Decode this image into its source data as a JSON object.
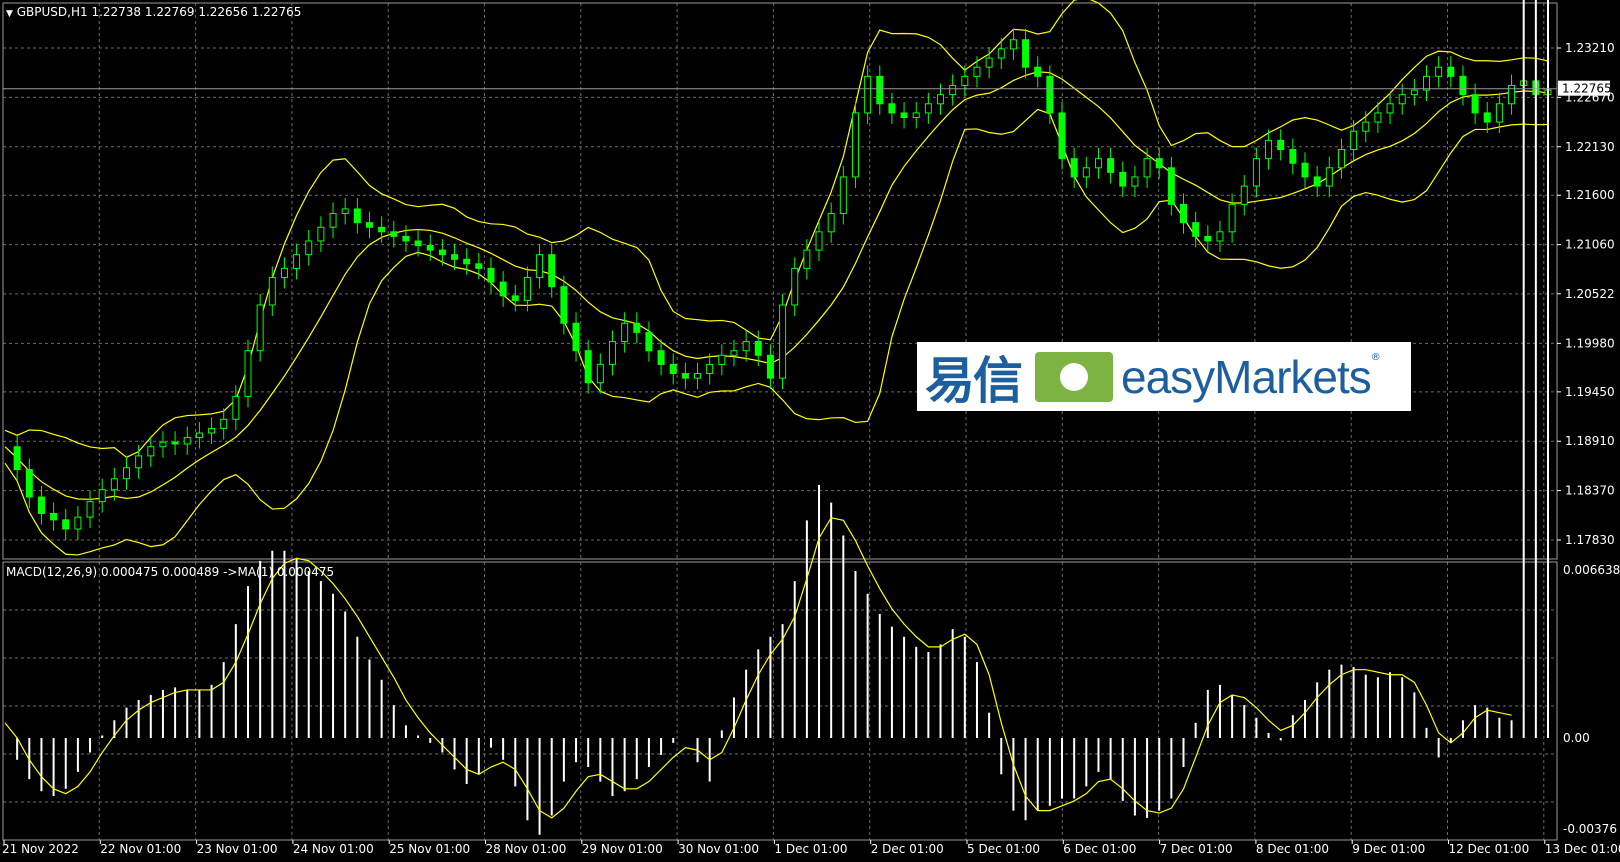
{
  "header": {
    "symbol_line": "GBPUSD,H1  1.22738 1.22769 1.22656 1.22765",
    "macd_line": "MACD(12,26,9) 0.000475 0.000489  ->MA(1) 0.000475"
  },
  "watermark": {
    "cn_text": "易信",
    "brand_text": "easyMarkets",
    "reg_mark": "®"
  },
  "colors": {
    "background": "#000000",
    "grid": "#6b6b6b",
    "candles": "#00ff00",
    "bands": "#ffff00",
    "macd_hist": "#ffffff",
    "signal": "#ffff00",
    "current_price_bg": "#ffffff"
  },
  "chart_data": [
    {
      "type": "line",
      "title": "GBPUSD,H1",
      "ohlc_last": {
        "open": 1.22738,
        "high": 1.22769,
        "low": 1.22656,
        "close": 1.22765
      },
      "current_price_label": "1.22765",
      "y_ticks": [
        "1.23210",
        "1.22670",
        "1.22130",
        "1.21600",
        "1.21060",
        "1.20522",
        "1.19980",
        "1.19450",
        "1.18910",
        "1.18370",
        "1.17830"
      ],
      "ylim": [
        1.1775,
        1.2365
      ],
      "x_ticks": [
        "21 Nov 2022",
        "22 Nov 01:00",
        "23 Nov 01:00",
        "24 Nov 01:00",
        "25 Nov 01:00",
        "28 Nov 01:00",
        "29 Nov 01:00",
        "30 Nov 01:00",
        "1 Dec 01:00",
        "2 Dec 01:00",
        "5 Dec 01:00",
        "6 Dec 01:00",
        "7 Dec 01:00",
        "8 Dec 01:00",
        "9 Dec 01:00",
        "12 Dec 01:00",
        "13 Dec 01:00"
      ],
      "grid": true,
      "series": [
        {
          "values": [
            1.1885,
            1.186,
            1.183,
            1.1812,
            1.1805,
            1.1795,
            1.1808,
            1.1825,
            1.1838,
            1.185,
            1.1862,
            1.1875,
            1.1885,
            1.189,
            1.1888,
            1.1895,
            1.19,
            1.1905,
            1.1915,
            1.194,
            1.199,
            1.204,
            1.207,
            1.208,
            1.2095,
            1.211,
            1.2125,
            1.214,
            1.2145,
            1.213,
            1.2125,
            1.212,
            1.2115,
            1.211,
            1.2105,
            1.21,
            1.2095,
            1.209,
            1.2085,
            1.208,
            1.2065,
            1.205,
            1.2045,
            1.207,
            1.2095,
            1.206,
            1.202,
            1.199,
            1.1955,
            1.1975,
            1.2,
            1.202,
            1.201,
            1.199,
            1.1975,
            1.1965,
            1.196,
            1.1965,
            1.1975,
            1.1985,
            1.199,
            1.2,
            1.1985,
            1.196,
            1.204,
            1.208,
            1.21,
            1.212,
            1.214,
            1.218,
            1.225,
            1.229,
            1.226,
            1.225,
            1.2245,
            1.225,
            1.226,
            1.227,
            1.228,
            1.229,
            1.23,
            1.231,
            1.232,
            1.233,
            1.23,
            1.229,
            1.225,
            1.22,
            1.218,
            1.219,
            1.22,
            1.2185,
            1.217,
            1.218,
            1.22,
            1.219,
            1.215,
            1.213,
            1.2115,
            1.211,
            1.212,
            1.215,
            1.217,
            1.22,
            1.222,
            1.221,
            1.2195,
            1.218,
            1.217,
            1.219,
            1.221,
            1.223,
            1.224,
            1.225,
            1.226,
            1.227,
            1.2275,
            1.229,
            1.23,
            1.229,
            1.227,
            1.225,
            1.224,
            1.226,
            1.228,
            1.2285,
            1.227,
            1.2275
          ]
        }
      ]
    },
    {
      "type": "bar",
      "title": "MACD(12,26,9)",
      "y_ticks": [
        "0.006638",
        "0.00",
        "-0.00376"
      ],
      "ylim": [
        -0.00376,
        0.006638
      ],
      "grid": true,
      "series": [
        {
          "values": [
            0.0,
            -0.0009,
            -0.0017,
            -0.0022,
            -0.0024,
            -0.0021,
            -0.0014,
            -0.0006,
            0.0001,
            0.0007,
            0.0012,
            0.0015,
            0.0017,
            0.0019,
            0.002,
            0.0019,
            0.0019,
            0.0021,
            0.003,
            0.0045,
            0.006,
            0.007,
            0.0074,
            0.0074,
            0.0071,
            0.0066,
            0.0062,
            0.0057,
            0.005,
            0.004,
            0.0031,
            0.0023,
            0.0013,
            0.0005,
            0.0001,
            -0.0002,
            -0.0006,
            -0.0013,
            -0.0019,
            -0.0015,
            -0.0004,
            -0.0009,
            -0.002,
            -0.0034,
            -0.004,
            -0.0032,
            -0.0018,
            -0.001,
            -0.0012,
            -0.0018,
            -0.0024,
            -0.0022,
            -0.0017,
            -0.0012,
            -0.0007,
            -0.0002,
            0.0,
            -0.001,
            -0.0018,
            0.0003,
            0.0016,
            0.0027,
            0.0035,
            0.004,
            0.0045,
            0.0062,
            0.0086,
            0.01,
            0.0093,
            0.008,
            0.0066,
            0.0057,
            0.0049,
            0.0044,
            0.004,
            0.0036,
            0.0034,
            0.0037,
            0.0043,
            0.004,
            0.003,
            0.001,
            -0.0015,
            -0.003,
            -0.0034,
            -0.003,
            -0.0028,
            -0.0025,
            -0.0025,
            -0.002,
            -0.0014,
            -0.0017,
            -0.0026,
            -0.0032,
            -0.0033,
            -0.003,
            -0.0025,
            -0.0012,
            0.0006,
            0.0019,
            0.0021,
            0.0017,
            0.0013,
            0.0008,
            0.0002,
            -0.0001,
            0.0009,
            0.0015,
            0.0022,
            0.0027,
            0.0029,
            0.0028,
            0.0025,
            0.0024,
            0.0026,
            0.0024,
            0.0018,
            0.0004,
            -0.0008,
            -0.0002,
            0.0007,
            0.0013,
            0.0012,
            0.0008,
            0.0007
          ]
        },
        {
          "name": "MA(1)",
          "values": [
            0.0006,
            0.0,
            -0.0009,
            -0.0016,
            -0.0021,
            -0.0023,
            -0.002,
            -0.0014,
            -0.0006,
            0.0001,
            0.0007,
            0.0011,
            0.0014,
            0.0016,
            0.0018,
            0.0019,
            0.0019,
            0.0019,
            0.0022,
            0.003,
            0.0041,
            0.0053,
            0.0063,
            0.0069,
            0.0071,
            0.007,
            0.0066,
            0.0061,
            0.0055,
            0.0048,
            0.004,
            0.0032,
            0.0024,
            0.0015,
            0.0008,
            0.0002,
            -0.0003,
            -0.0008,
            -0.0013,
            -0.0015,
            -0.0012,
            -0.001,
            -0.0013,
            -0.0021,
            -0.003,
            -0.0033,
            -0.0029,
            -0.0022,
            -0.0016,
            -0.0015,
            -0.0018,
            -0.0021,
            -0.0021,
            -0.0018,
            -0.0013,
            -0.0008,
            -0.0004,
            -0.0005,
            -0.0009,
            -0.0006,
            0.0004,
            0.0015,
            0.0025,
            0.0033,
            0.0039,
            0.0048,
            0.0063,
            0.0079,
            0.0087,
            0.0086,
            0.0078,
            0.0068,
            0.0059,
            0.0051,
            0.0045,
            0.004,
            0.0036,
            0.0036,
            0.0039,
            0.0041,
            0.0037,
            0.0025,
            0.0006,
            -0.0011,
            -0.0024,
            -0.003,
            -0.003,
            -0.0028,
            -0.0026,
            -0.0023,
            -0.0018,
            -0.0017,
            -0.0021,
            -0.0026,
            -0.003,
            -0.0031,
            -0.0029,
            -0.0021,
            -0.0008,
            0.0005,
            0.0014,
            0.0017,
            0.0016,
            0.0012,
            0.0007,
            0.0003,
            0.0005,
            0.001,
            0.0016,
            0.0021,
            0.0025,
            0.0027,
            0.0027,
            0.0026,
            0.0025,
            0.0025,
            0.0022,
            0.0013,
            0.0002,
            -0.0002,
            0.0002,
            0.0008,
            0.0011,
            0.001,
            0.0009
          ]
        }
      ]
    }
  ]
}
